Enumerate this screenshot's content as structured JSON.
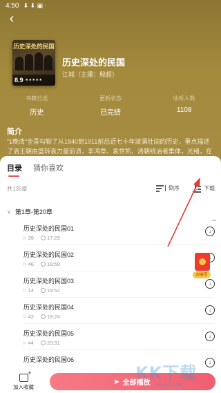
{
  "status_bar": {
    "time": "4:50",
    "icons": "⬇ ⬇ ▣ ·"
  },
  "book": {
    "cover_title": "历史深处的民国",
    "cover_score": "8.9",
    "cover_stars": "★★★★★",
    "title": "历史深处的民国",
    "author": "江城（主播：殷超）"
  },
  "meta": [
    {
      "label": "书籍分类",
      "value": "历史"
    },
    {
      "label": "更新状态",
      "value": "已完结"
    },
    {
      "label": "收听人数",
      "value": "1108"
    }
  ],
  "intro": {
    "title": "简介",
    "text": "“1晚清”全景勾勒了从1840到1911前后近七十年波澜壮阔的历史，重点描述了清王朝由盛转衰力量前溃，李鸿章、袁世凯、清朝统治者集体，光绪，在野力量革命"
  },
  "tabs": [
    {
      "label": "目录",
      "active": true
    },
    {
      "label": "猜你喜欢",
      "active": false
    }
  ],
  "toolbar": {
    "total": "共135章",
    "sort_label": "倒序",
    "download_label": "下载"
  },
  "section": {
    "label": "第1章-第20章"
  },
  "episodes": [
    {
      "title": "历史深处的民国01",
      "plays": "39",
      "duration": "17:29"
    },
    {
      "title": "历史深处的民国02",
      "plays": "46",
      "duration": "18:59"
    },
    {
      "title": "历史深处的民国03",
      "plays": "14",
      "duration": "19:52"
    },
    {
      "title": "历史深处的民国04",
      "plays": "42",
      "duration": "18:24"
    },
    {
      "title": "历史深处的民国05",
      "plays": "44",
      "duration": "20:31"
    },
    {
      "title": "历史深处的民国06",
      "plays": "",
      "duration": ""
    }
  ],
  "redpack": {
    "label": "20金币"
  },
  "bottom": {
    "favorite_label": "加入收藏",
    "play_all_label": "全部播放"
  },
  "watermark": {
    "text": "KK下载",
    "url": "www.kkx.net"
  },
  "colors": {
    "hero": "#a48a3d",
    "accent": "#f05f72",
    "arrow": "#e53935"
  }
}
